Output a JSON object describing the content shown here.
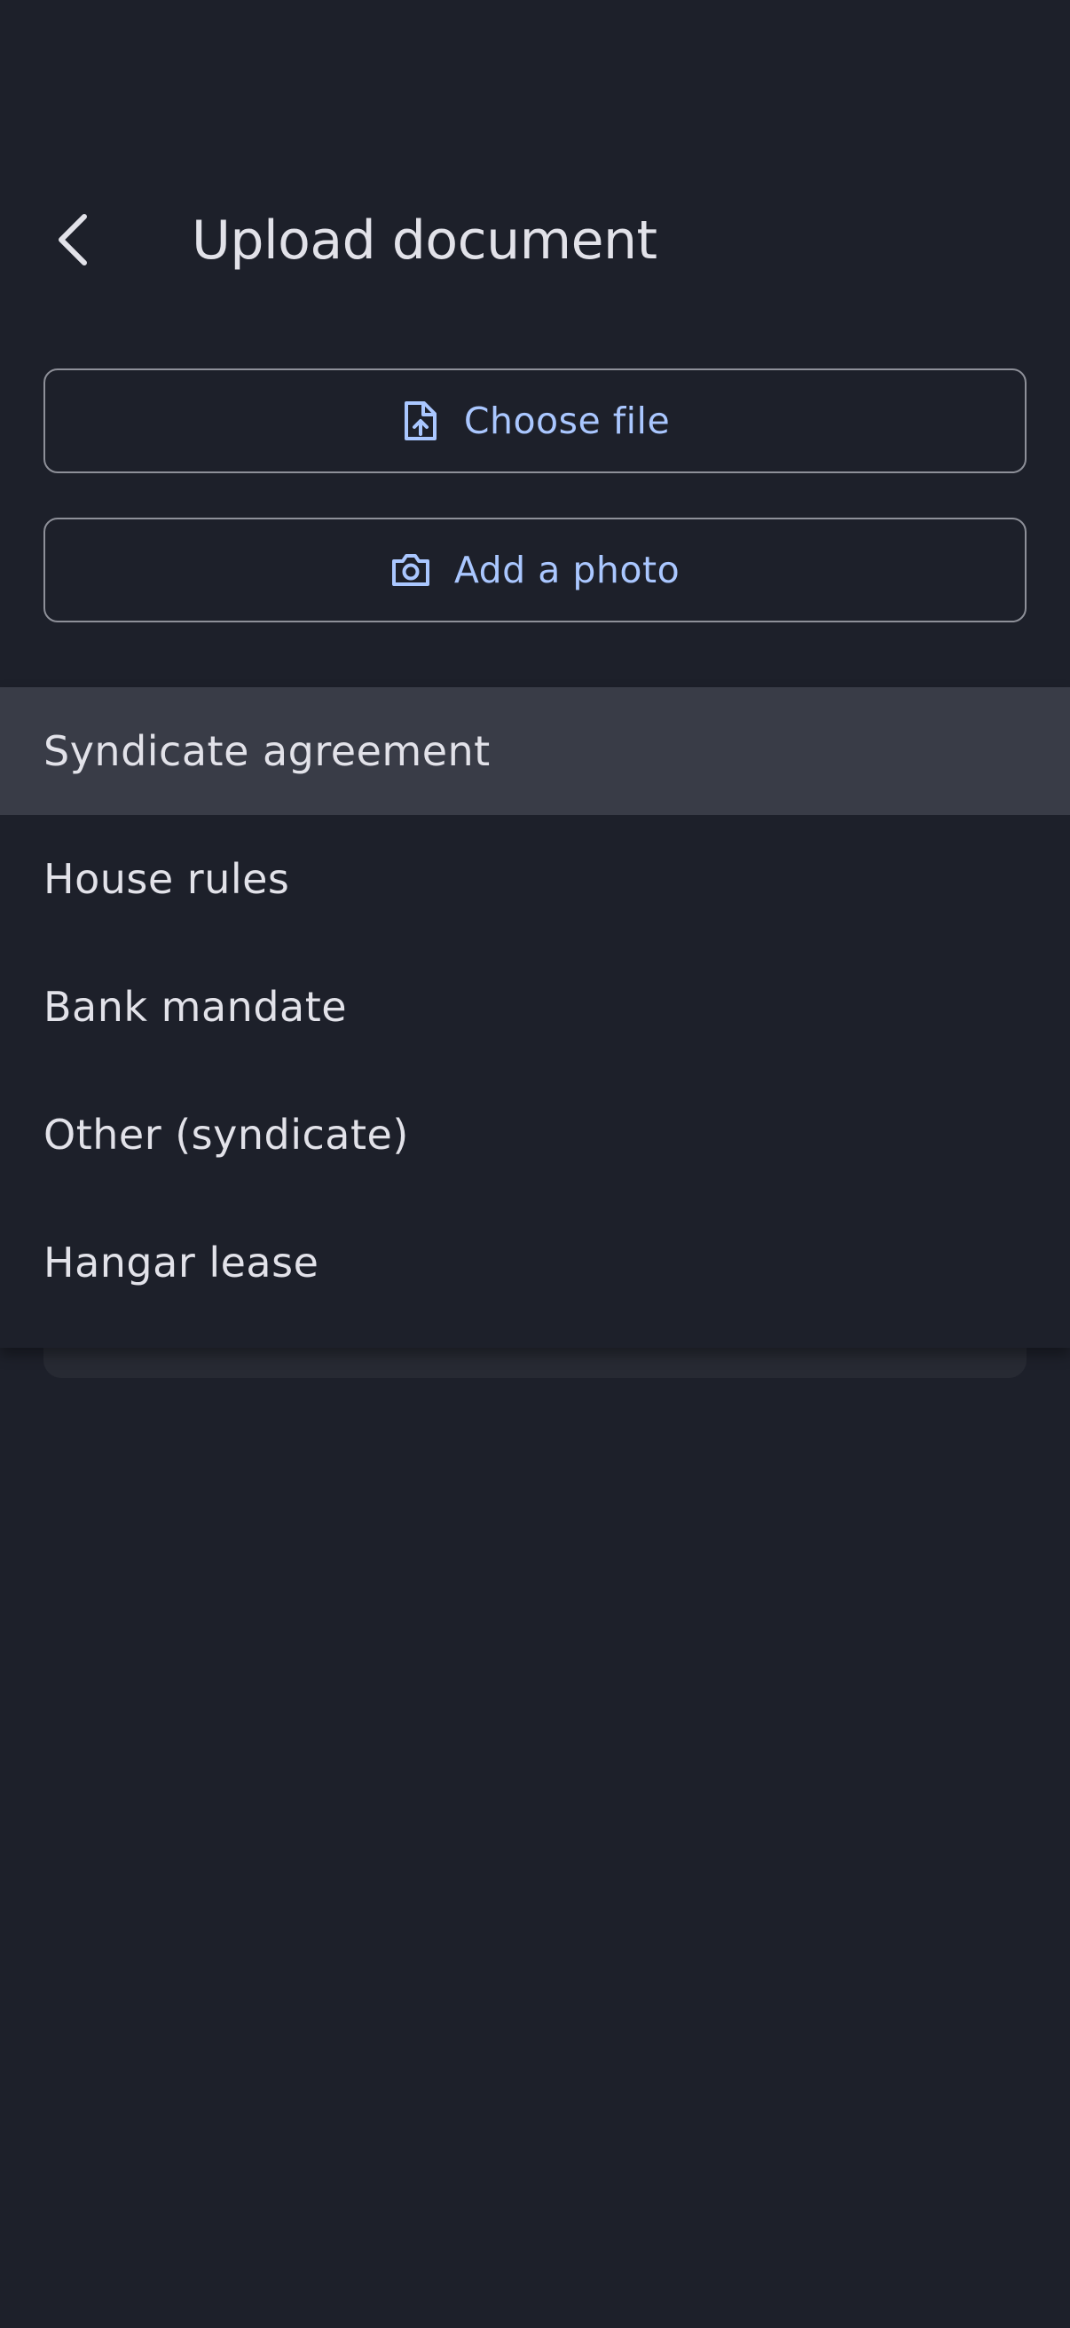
{
  "header": {
    "back_icon": "chevron-left-icon",
    "title": "Upload document"
  },
  "actions": {
    "choose_file": {
      "label": "Choose file",
      "icon": "file-upload-icon"
    },
    "add_photo": {
      "label": "Add a photo",
      "icon": "camera-icon"
    }
  },
  "colors": {
    "background": "#1d202a",
    "accent": "#aac7ff",
    "outline": "#8e9099",
    "selected_item": "#393c47",
    "text": "#e2e2e9"
  },
  "menu": {
    "items": [
      {
        "label": "Syndicate agreement",
        "selected": true
      },
      {
        "label": "House rules",
        "selected": false
      },
      {
        "label": "Bank mandate",
        "selected": false
      },
      {
        "label": "Other (syndicate)",
        "selected": false
      },
      {
        "label": "Hangar lease",
        "selected": false
      }
    ]
  }
}
